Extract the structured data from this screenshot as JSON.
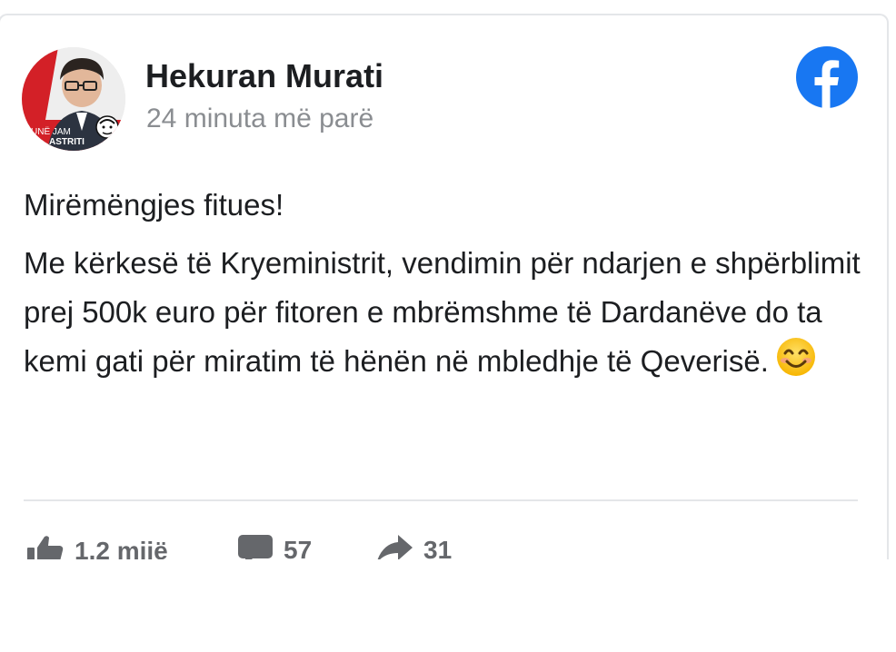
{
  "post": {
    "author": "Hekuran Murati",
    "timestamp": "24 minuta më parë",
    "avatar_badge_line1": "UNË JAM",
    "avatar_badge_line2": "ASTRITI",
    "greeting": "Mirëmëngjes fitues!",
    "body": "Me kërkesë të Kryeministrit, vendimin për ndarjen e shpërblimit prej 500k euro për fitoren e mbrëmshme të Dardanëve do ta kemi gati për miratim të hënën në mbledhje të Qeverisë."
  },
  "stats": {
    "likes": "1.2 mijë",
    "comments": "57",
    "shares": "31"
  },
  "icons": {
    "platform": "facebook-icon",
    "like": "thumbs-up-icon",
    "comment": "comment-icon",
    "share": "share-arrow-icon",
    "emoji": "smiling-face-icon"
  },
  "colors": {
    "facebook_blue": "#1877f2",
    "text_primary": "#1c1e21",
    "text_secondary": "#8a8d91",
    "action_gray": "#65676b",
    "avatar_red": "#d32027"
  }
}
